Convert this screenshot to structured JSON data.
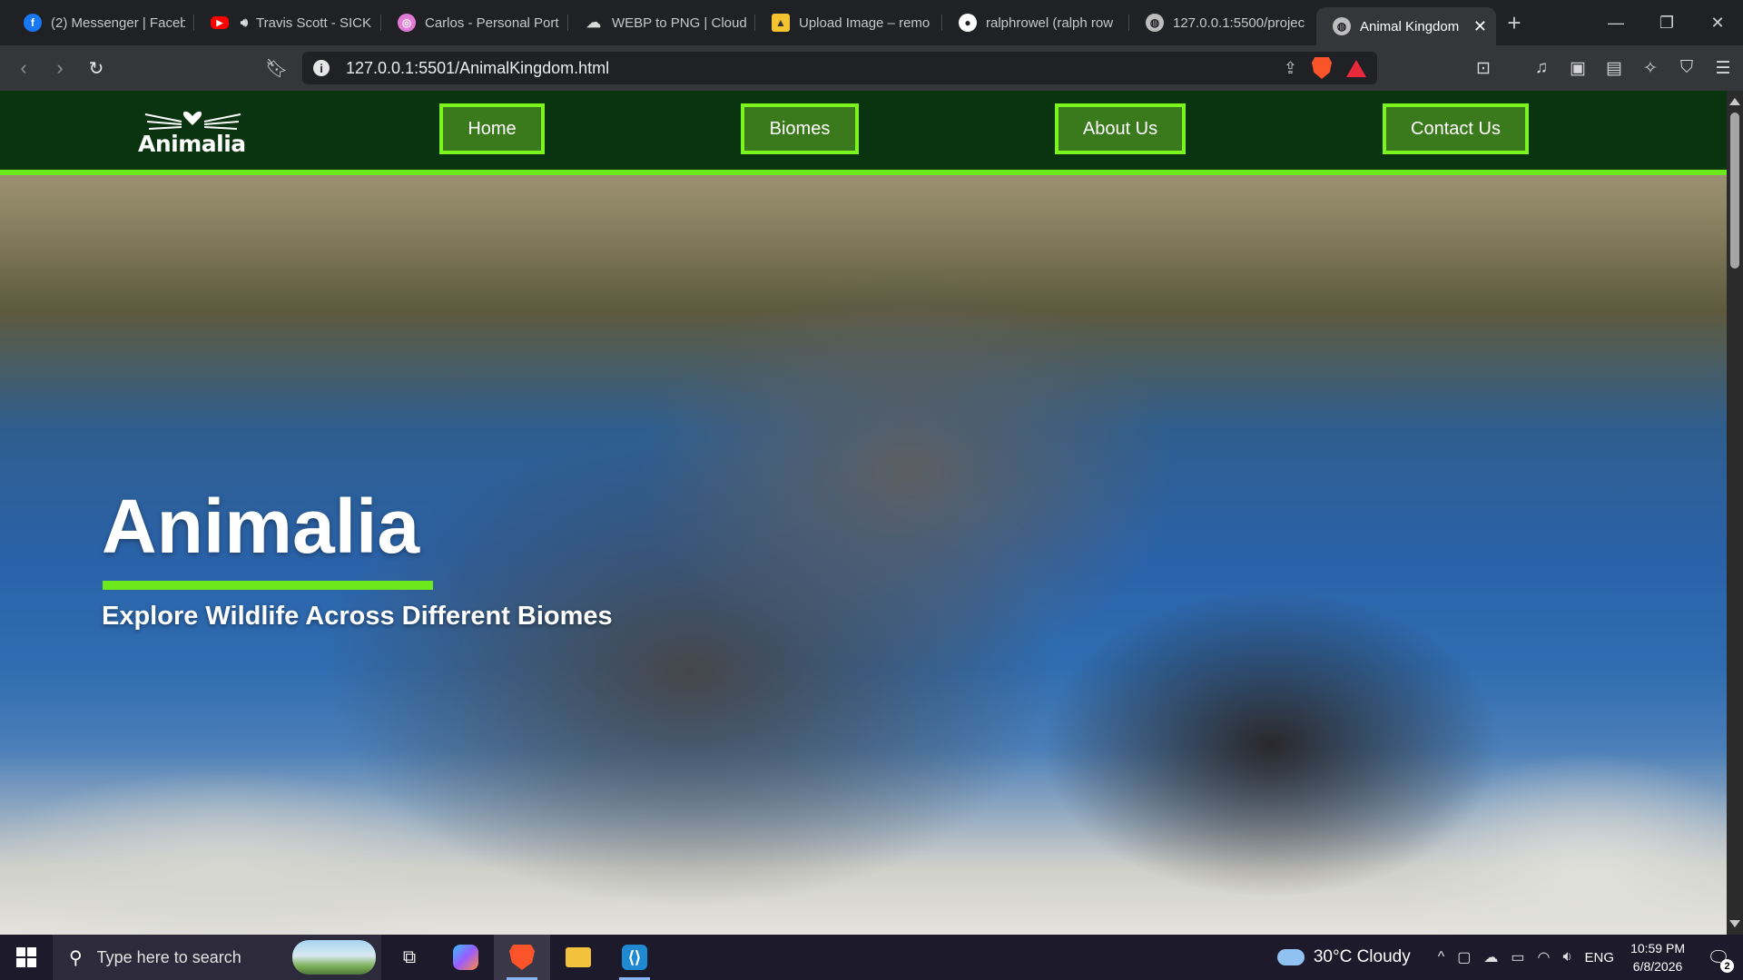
{
  "browser": {
    "tabs": [
      {
        "title": "(2) Messenger | Faceb",
        "icon": "facebook-icon",
        "color": "#1877f2"
      },
      {
        "title": "Travis Scott - SICK",
        "icon": "youtube-icon",
        "color": "#ff0000"
      },
      {
        "title": "Carlos - Personal Port",
        "icon": "portfolio-icon",
        "color": "#e17bd6"
      },
      {
        "title": "WEBP to PNG | Cloud",
        "icon": "cloud-icon",
        "color": "#d8d8d8"
      },
      {
        "title": "Upload Image – remo",
        "icon": "upload-icon",
        "color": "#f3c430"
      },
      {
        "title": "ralphrowel (ralph row",
        "icon": "github-icon",
        "color": "#ffffff"
      },
      {
        "title": "127.0.0.1:5500/projec",
        "icon": "globe-icon",
        "color": "#bdbdbd"
      },
      {
        "title": "Animal Kingdom",
        "icon": "globe-icon",
        "color": "#bdbdbd",
        "active": true
      }
    ],
    "url": "127.0.0.1:5501/AnimalKingdom.html"
  },
  "site": {
    "logo_text": "Animalia",
    "nav": [
      "Home",
      "Biomes",
      "About Us",
      "Contact Us"
    ],
    "hero_title": "Animalia",
    "hero_subtitle": "Explore Wildlife Across Different Biomes",
    "accent": "#6ce81c",
    "header_bg": "#0a3310"
  },
  "taskbar": {
    "search_placeholder": "Type here to search",
    "weather": "30°C  Cloudy",
    "lang": "ENG",
    "time": "10:59 PM",
    "date": "6/8/2026",
    "notification_count": "2"
  }
}
